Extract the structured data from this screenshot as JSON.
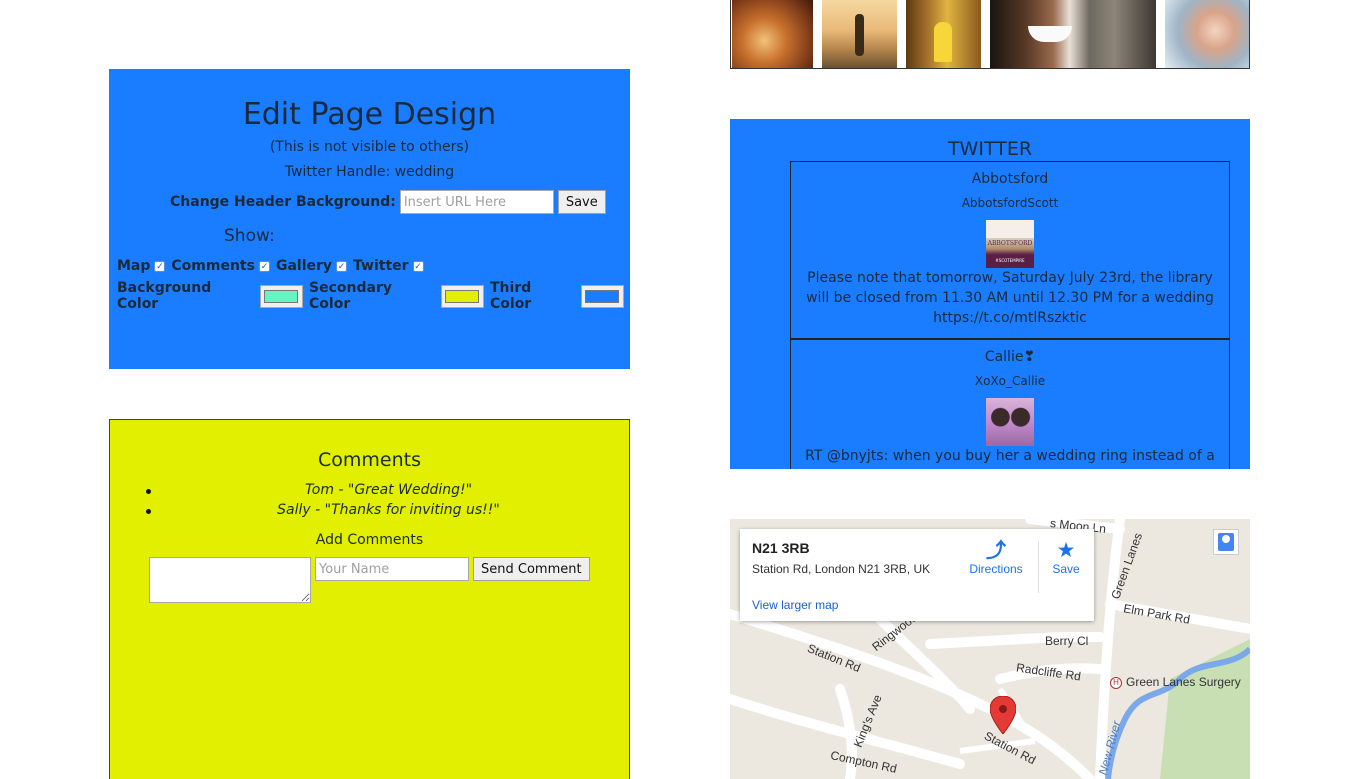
{
  "edit_design": {
    "title": "Edit Page Design",
    "subtitle": "(This is not visible to others)",
    "twitter_handle": "Twitter Handle: wedding",
    "header_bg_label": "Change Header Background:",
    "url_placeholder": "Insert URL Here",
    "save_label": "Save",
    "show_label": "Show:",
    "toggles": [
      {
        "label": "Map",
        "checked": true
      },
      {
        "label": "Comments",
        "checked": true
      },
      {
        "label": "Gallery",
        "checked": true
      },
      {
        "label": "Twitter",
        "checked": true
      }
    ],
    "colors": [
      {
        "label": "Background Color",
        "value": "#64f5c3"
      },
      {
        "label": "Secondary Color",
        "value": "#e2f000"
      },
      {
        "label": "Third Color",
        "value": "#1a7dff"
      }
    ]
  },
  "comments": {
    "title": "Comments",
    "items": [
      {
        "author": "Tom",
        "text": "Tom - \"Great Wedding!\""
      },
      {
        "author": "Sally",
        "text": "Sally - \"Thanks for inviting us!!\""
      }
    ],
    "add_label": "Add Comments",
    "name_placeholder": "Your Name",
    "send_label": "Send Comment"
  },
  "gallery": {
    "photos": [
      "autumn-leaves-photo",
      "bicycle-girl-photo",
      "yellow-dress-photo",
      "man-with-cat-photo",
      "child-portrait-photo"
    ]
  },
  "twitter": {
    "title": "TWITTER",
    "tweets": [
      {
        "name": "Abbotsford",
        "handle": "AbbotsfordScott",
        "text": "Please note that tomorrow, Saturday July 23rd, the library will be closed from 11.30 AM until 12.30 PM for a wedding https://t.co/mtlRszktic"
      },
      {
        "name": "Callie❣",
        "handle": "XoXo_Callie",
        "text": "RT @bnyjts: when you buy her a wedding ring instead of a getting"
      }
    ]
  },
  "map": {
    "place_title": "N21 3RB",
    "address": "Station Rd, London N21 3RB, UK",
    "larger_map": "View larger map",
    "directions_label": "Directions",
    "save_label": "Save",
    "streets": {
      "station_rd_1": "Station Rd",
      "station_rd_2": "Station Rd",
      "ringwood": "Ringwood",
      "radcliffe": "Radcliffe Rd",
      "berry": "Berry Cl",
      "elm_park": "Elm Park Rd",
      "green_lanes": "Green Lanes",
      "moon": "s Moon Ln",
      "kings": "King's Ave",
      "compton": "Compton Rd",
      "new_river": "New River",
      "surgery": "Green Lanes Surgery"
    }
  }
}
